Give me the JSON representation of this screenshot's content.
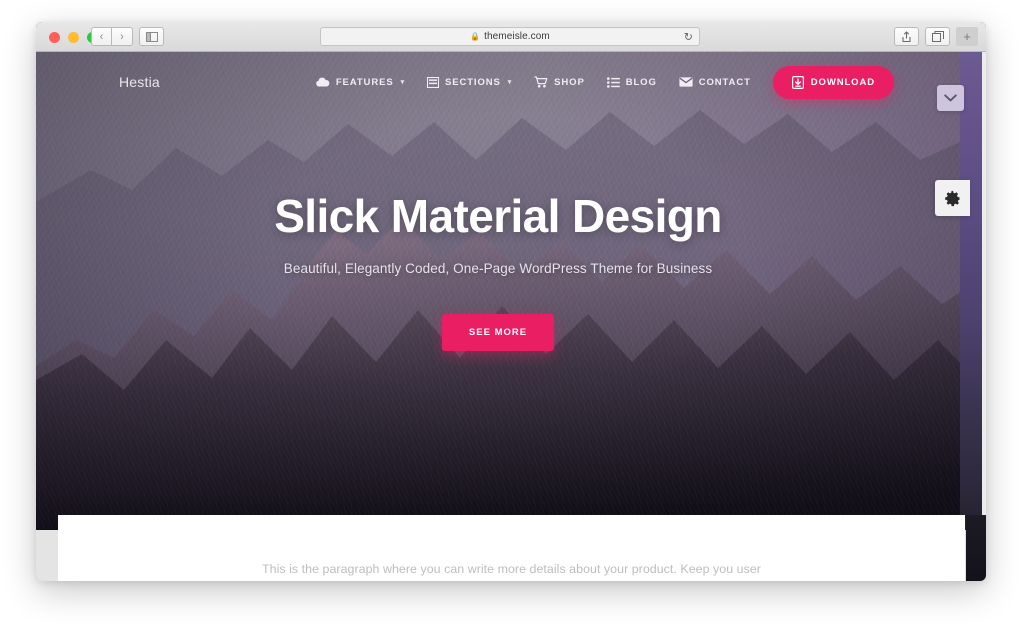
{
  "browser": {
    "traffic_lights": [
      "close",
      "minimize",
      "maximize"
    ],
    "back_label": "‹",
    "forward_label": "›",
    "sidebar_icon": "sidebar-icon",
    "url": "themeisle.com",
    "lock_icon": "🔒",
    "reload_icon": "↻",
    "share_icon": "share-icon",
    "tabs_icon": "tabs-icon",
    "new_tab_label": "+"
  },
  "site": {
    "brand": "Hestia",
    "menu": [
      {
        "label": "FEATURES",
        "icon": "cloud-icon",
        "has_dropdown": true,
        "caret": "▾"
      },
      {
        "label": "SECTIONS",
        "icon": "sections-icon",
        "has_dropdown": true,
        "caret": "▾"
      },
      {
        "label": "SHOP",
        "icon": "cart-icon",
        "has_dropdown": false,
        "caret": ""
      },
      {
        "label": "BLOG",
        "icon": "list-icon",
        "has_dropdown": false,
        "caret": ""
      },
      {
        "label": "CONTACT",
        "icon": "envelope-icon",
        "has_dropdown": false,
        "caret": ""
      }
    ],
    "download_button": {
      "label": "DOWNLOAD",
      "icon": "download-icon",
      "color": "#e91e63"
    }
  },
  "hero": {
    "title": "Slick Material Design",
    "subtitle": "Beautiful, Elegantly Coded, One-Page WordPress Theme for Business",
    "cta_label": "SEE MORE",
    "cta_color": "#e91e63"
  },
  "widgets": {
    "chevron_icon": "chevron-down-icon",
    "chevron_color": "#cdc4de",
    "gear_icon": "gear-icon",
    "gear_bg": "#f1f1f1"
  },
  "content": {
    "paragraph": "This is the paragraph where you can write more details about your product. Keep you user engaged by providing meaningful information. Remember that by this time, the user is curious,"
  },
  "colors": {
    "accent": "#e91e63",
    "page_bg": "#ececec",
    "card_bg": "#ffffff",
    "paragraph_text": "#bdbdbd"
  }
}
